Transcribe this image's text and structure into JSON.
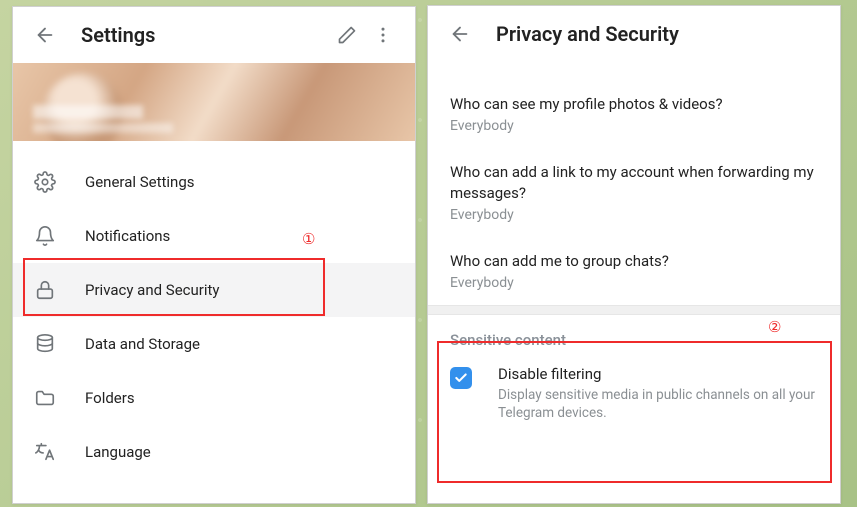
{
  "left": {
    "title": "Settings",
    "items": [
      {
        "label": "General Settings"
      },
      {
        "label": "Notifications"
      },
      {
        "label": "Privacy and Security"
      },
      {
        "label": "Data and Storage"
      },
      {
        "label": "Folders"
      },
      {
        "label": "Language"
      }
    ]
  },
  "right": {
    "title": "Privacy and Security",
    "privacy": [
      {
        "title": "Who can see my profile photos & videos?",
        "value": "Everybody"
      },
      {
        "title": "Who can add a link to my account when forwarding my messages?",
        "value": "Everybody"
      },
      {
        "title": "Who can add me to group chats?",
        "value": "Everybody"
      }
    ],
    "section_label": "Sensitive content",
    "check": {
      "title": "Disable filtering",
      "desc": "Display sensitive media in public channels on all your Telegram devices."
    }
  },
  "annotations": {
    "one": "①",
    "two": "②"
  }
}
